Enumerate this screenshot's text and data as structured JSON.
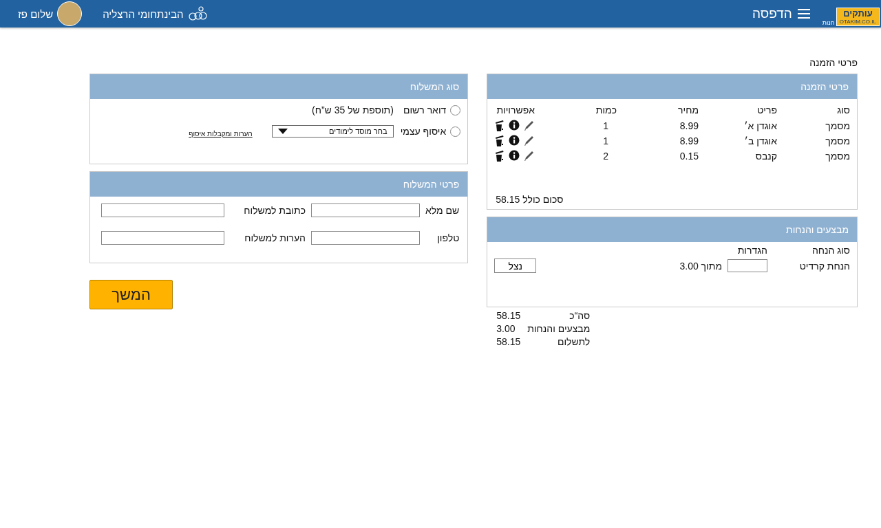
{
  "header": {
    "logo": {
      "title": "עותקים",
      "subtitle": "OTAKIM.CO.IL",
      "tag": "חנות"
    },
    "menu_label": "הדפסה",
    "institution": "הבינתחומי הרצליה",
    "greeting": "שלום פז"
  },
  "page_title": "פרטי הזמנה",
  "order": {
    "title": "פרטי הזמנה",
    "columns": [
      "סוג",
      "פריט",
      "מחיר",
      "כמות",
      "אפשרויות"
    ],
    "rows": [
      {
        "type": "מסמך",
        "item": "אוגדן א׳",
        "price": "8.99",
        "quantity": "1"
      },
      {
        "type": "מסמך",
        "item": "אוגדן ב׳",
        "price": "8.99",
        "quantity": "1"
      },
      {
        "type": "מסמך",
        "item": "קנבס",
        "price": "0.15",
        "quantity": "2"
      }
    ],
    "total_label": "סכום כולל",
    "total": "58.15"
  },
  "discounts": {
    "title": "מבצעים והנחות",
    "columns": [
      "סוג הנחה",
      "הגדרות"
    ],
    "rows": [
      {
        "type": "הנחת קרדיט",
        "of_label": "מתוך",
        "max": "3.00",
        "button": "נצל"
      }
    ]
  },
  "summary": [
    {
      "label": "סה“כ",
      "value": "58.15"
    },
    {
      "label": "מבצעים והנחות",
      "value": "3.00"
    },
    {
      "label": "לתשלום",
      "value": "58.15"
    }
  ],
  "shipping_type": {
    "title": "סוג המשלוח",
    "options": [
      {
        "kind": "mail",
        "label": "דואר רשום",
        "note": "(תוספת של 35 ש”ח)",
        "selected": false
      },
      {
        "kind": "pickup",
        "label": "איסוף עצמי",
        "select": "בחר מוסד לימודים",
        "link": "הערות ומקבלות איסוף",
        "selected": false
      }
    ]
  },
  "shipping_details": {
    "title": "פרטי המשלוח",
    "fields": [
      {
        "label": "שם מלא"
      },
      {
        "label": "כתובת למשלוח"
      },
      {
        "label": "טלפון"
      },
      {
        "label": "הערות למשלוח"
      }
    ]
  },
  "continue_button": "המשך"
}
